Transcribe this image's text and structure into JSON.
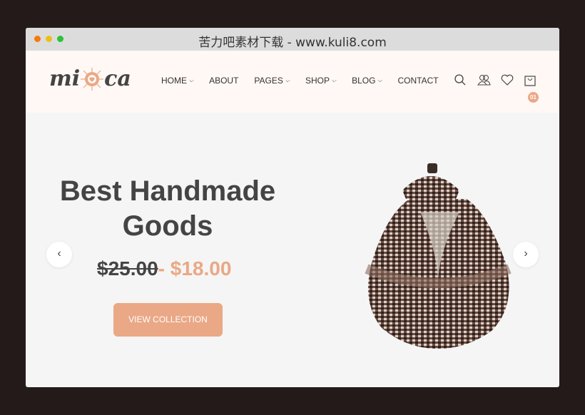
{
  "window": {
    "title": "苦力吧素材下载 - www.kuli8.com"
  },
  "header": {
    "logo": "mi ca",
    "nav": [
      {
        "label": "HOME",
        "dropdown": true
      },
      {
        "label": "ABOUT",
        "dropdown": false
      },
      {
        "label": "PAGES",
        "dropdown": true
      },
      {
        "label": "SHOP",
        "dropdown": true
      },
      {
        "label": "BLOG",
        "dropdown": true
      },
      {
        "label": "CONTACT",
        "dropdown": false
      }
    ],
    "cart_count": "01"
  },
  "hero": {
    "title": "Best Handmade Goods",
    "old_price": "$25.00",
    "separator": "-",
    "new_price": "$18.00",
    "cta": "VIEW COLLECTION"
  },
  "colors": {
    "accent": "#eaa886",
    "header_bg": "#fff8f5",
    "hero_bg": "#f5f5f5"
  }
}
